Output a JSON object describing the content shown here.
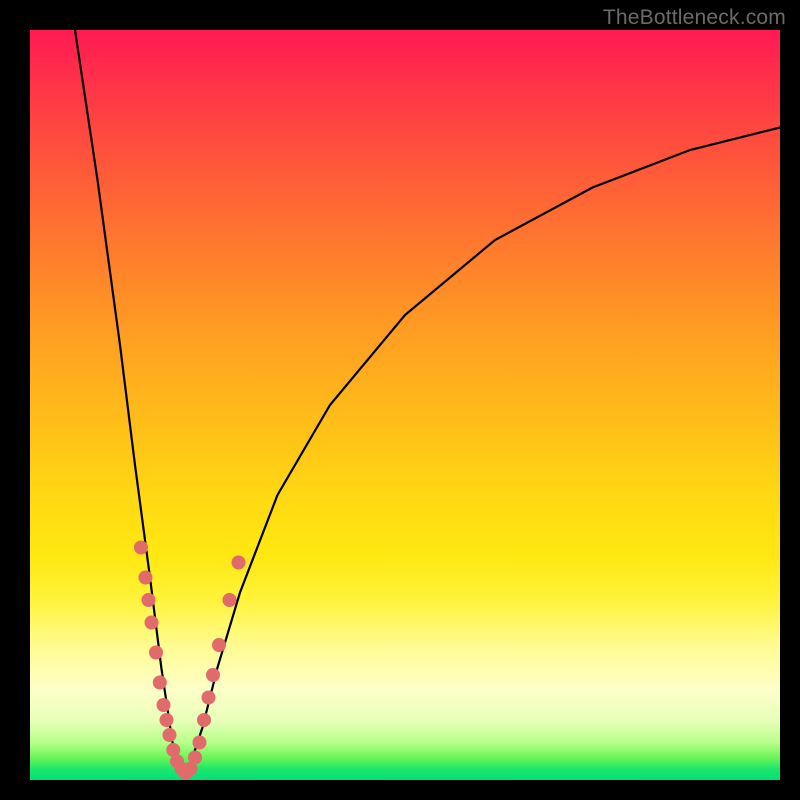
{
  "watermark": "TheBottleneck.com",
  "colors": {
    "frame": "#000000",
    "curve": "#000000",
    "dots": "#e16a6a",
    "gradient_top": "#ff1a52",
    "gradient_bottom": "#00df7a"
  },
  "chart_data": {
    "type": "line",
    "title": "",
    "xlabel": "",
    "ylabel": "",
    "xlim": [
      0,
      100
    ],
    "ylim": [
      0,
      100
    ],
    "note": "Axes carry no tick labels in the source image; the plot shows bottleneck percentage (y, high=bad/red) vs. component performance (x). The V-shaped curve dips to ~0 around x≈20 indicating the balanced point.",
    "series": [
      {
        "name": "bottleneck-curve",
        "points": [
          {
            "x": 6,
            "y": 100
          },
          {
            "x": 9,
            "y": 80
          },
          {
            "x": 12,
            "y": 58
          },
          {
            "x": 14,
            "y": 42
          },
          {
            "x": 16,
            "y": 27
          },
          {
            "x": 17.5,
            "y": 15
          },
          {
            "x": 19,
            "y": 5
          },
          {
            "x": 20,
            "y": 1
          },
          {
            "x": 21,
            "y": 1
          },
          {
            "x": 23,
            "y": 7
          },
          {
            "x": 25,
            "y": 15
          },
          {
            "x": 28,
            "y": 25
          },
          {
            "x": 33,
            "y": 38
          },
          {
            "x": 40,
            "y": 50
          },
          {
            "x": 50,
            "y": 62
          },
          {
            "x": 62,
            "y": 72
          },
          {
            "x": 75,
            "y": 79
          },
          {
            "x": 88,
            "y": 84
          },
          {
            "x": 100,
            "y": 87
          }
        ]
      }
    ],
    "highlight_points": [
      {
        "x": 14.8,
        "y": 31
      },
      {
        "x": 15.4,
        "y": 27
      },
      {
        "x": 15.8,
        "y": 24
      },
      {
        "x": 16.2,
        "y": 21
      },
      {
        "x": 16.8,
        "y": 17
      },
      {
        "x": 17.3,
        "y": 13
      },
      {
        "x": 17.8,
        "y": 10
      },
      {
        "x": 18.2,
        "y": 8
      },
      {
        "x": 18.6,
        "y": 6
      },
      {
        "x": 19.1,
        "y": 4
      },
      {
        "x": 19.6,
        "y": 2.5
      },
      {
        "x": 20.2,
        "y": 1.5
      },
      {
        "x": 20.8,
        "y": 1
      },
      {
        "x": 21.4,
        "y": 1.5
      },
      {
        "x": 22.0,
        "y": 3
      },
      {
        "x": 22.6,
        "y": 5
      },
      {
        "x": 23.2,
        "y": 8
      },
      {
        "x": 23.8,
        "y": 11
      },
      {
        "x": 24.4,
        "y": 14
      },
      {
        "x": 25.2,
        "y": 18
      },
      {
        "x": 26.6,
        "y": 24
      },
      {
        "x": 27.8,
        "y": 29
      }
    ]
  }
}
